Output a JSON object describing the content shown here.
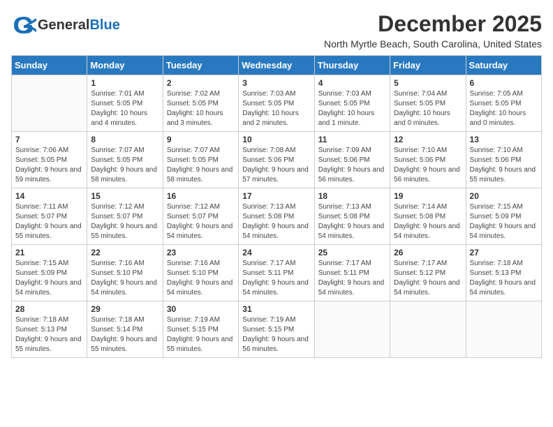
{
  "header": {
    "logo_general": "General",
    "logo_blue": "Blue",
    "month_title": "December 2025",
    "location": "North Myrtle Beach, South Carolina, United States"
  },
  "days_of_week": [
    "Sunday",
    "Monday",
    "Tuesday",
    "Wednesday",
    "Thursday",
    "Friday",
    "Saturday"
  ],
  "weeks": [
    [
      {
        "day": "",
        "sunrise": "",
        "sunset": "",
        "daylight": ""
      },
      {
        "day": "1",
        "sunrise": "Sunrise: 7:01 AM",
        "sunset": "Sunset: 5:05 PM",
        "daylight": "Daylight: 10 hours and 4 minutes."
      },
      {
        "day": "2",
        "sunrise": "Sunrise: 7:02 AM",
        "sunset": "Sunset: 5:05 PM",
        "daylight": "Daylight: 10 hours and 3 minutes."
      },
      {
        "day": "3",
        "sunrise": "Sunrise: 7:03 AM",
        "sunset": "Sunset: 5:05 PM",
        "daylight": "Daylight: 10 hours and 2 minutes."
      },
      {
        "day": "4",
        "sunrise": "Sunrise: 7:03 AM",
        "sunset": "Sunset: 5:05 PM",
        "daylight": "Daylight: 10 hours and 1 minute."
      },
      {
        "day": "5",
        "sunrise": "Sunrise: 7:04 AM",
        "sunset": "Sunset: 5:05 PM",
        "daylight": "Daylight: 10 hours and 0 minutes."
      },
      {
        "day": "6",
        "sunrise": "Sunrise: 7:05 AM",
        "sunset": "Sunset: 5:05 PM",
        "daylight": "Daylight: 10 hours and 0 minutes."
      }
    ],
    [
      {
        "day": "7",
        "sunrise": "Sunrise: 7:06 AM",
        "sunset": "Sunset: 5:05 PM",
        "daylight": "Daylight: 9 hours and 59 minutes."
      },
      {
        "day": "8",
        "sunrise": "Sunrise: 7:07 AM",
        "sunset": "Sunset: 5:05 PM",
        "daylight": "Daylight: 9 hours and 58 minutes."
      },
      {
        "day": "9",
        "sunrise": "Sunrise: 7:07 AM",
        "sunset": "Sunset: 5:05 PM",
        "daylight": "Daylight: 9 hours and 58 minutes."
      },
      {
        "day": "10",
        "sunrise": "Sunrise: 7:08 AM",
        "sunset": "Sunset: 5:06 PM",
        "daylight": "Daylight: 9 hours and 57 minutes."
      },
      {
        "day": "11",
        "sunrise": "Sunrise: 7:09 AM",
        "sunset": "Sunset: 5:06 PM",
        "daylight": "Daylight: 9 hours and 56 minutes."
      },
      {
        "day": "12",
        "sunrise": "Sunrise: 7:10 AM",
        "sunset": "Sunset: 5:06 PM",
        "daylight": "Daylight: 9 hours and 56 minutes."
      },
      {
        "day": "13",
        "sunrise": "Sunrise: 7:10 AM",
        "sunset": "Sunset: 5:06 PM",
        "daylight": "Daylight: 9 hours and 55 minutes."
      }
    ],
    [
      {
        "day": "14",
        "sunrise": "Sunrise: 7:11 AM",
        "sunset": "Sunset: 5:07 PM",
        "daylight": "Daylight: 9 hours and 55 minutes."
      },
      {
        "day": "15",
        "sunrise": "Sunrise: 7:12 AM",
        "sunset": "Sunset: 5:07 PM",
        "daylight": "Daylight: 9 hours and 55 minutes."
      },
      {
        "day": "16",
        "sunrise": "Sunrise: 7:12 AM",
        "sunset": "Sunset: 5:07 PM",
        "daylight": "Daylight: 9 hours and 54 minutes."
      },
      {
        "day": "17",
        "sunrise": "Sunrise: 7:13 AM",
        "sunset": "Sunset: 5:08 PM",
        "daylight": "Daylight: 9 hours and 54 minutes."
      },
      {
        "day": "18",
        "sunrise": "Sunrise: 7:13 AM",
        "sunset": "Sunset: 5:08 PM",
        "daylight": "Daylight: 9 hours and 54 minutes."
      },
      {
        "day": "19",
        "sunrise": "Sunrise: 7:14 AM",
        "sunset": "Sunset: 5:08 PM",
        "daylight": "Daylight: 9 hours and 54 minutes."
      },
      {
        "day": "20",
        "sunrise": "Sunrise: 7:15 AM",
        "sunset": "Sunset: 5:09 PM",
        "daylight": "Daylight: 9 hours and 54 minutes."
      }
    ],
    [
      {
        "day": "21",
        "sunrise": "Sunrise: 7:15 AM",
        "sunset": "Sunset: 5:09 PM",
        "daylight": "Daylight: 9 hours and 54 minutes."
      },
      {
        "day": "22",
        "sunrise": "Sunrise: 7:16 AM",
        "sunset": "Sunset: 5:10 PM",
        "daylight": "Daylight: 9 hours and 54 minutes."
      },
      {
        "day": "23",
        "sunrise": "Sunrise: 7:16 AM",
        "sunset": "Sunset: 5:10 PM",
        "daylight": "Daylight: 9 hours and 54 minutes."
      },
      {
        "day": "24",
        "sunrise": "Sunrise: 7:17 AM",
        "sunset": "Sunset: 5:11 PM",
        "daylight": "Daylight: 9 hours and 54 minutes."
      },
      {
        "day": "25",
        "sunrise": "Sunrise: 7:17 AM",
        "sunset": "Sunset: 5:11 PM",
        "daylight": "Daylight: 9 hours and 54 minutes."
      },
      {
        "day": "26",
        "sunrise": "Sunrise: 7:17 AM",
        "sunset": "Sunset: 5:12 PM",
        "daylight": "Daylight: 9 hours and 54 minutes."
      },
      {
        "day": "27",
        "sunrise": "Sunrise: 7:18 AM",
        "sunset": "Sunset: 5:13 PM",
        "daylight": "Daylight: 9 hours and 54 minutes."
      }
    ],
    [
      {
        "day": "28",
        "sunrise": "Sunrise: 7:18 AM",
        "sunset": "Sunset: 5:13 PM",
        "daylight": "Daylight: 9 hours and 55 minutes."
      },
      {
        "day": "29",
        "sunrise": "Sunrise: 7:18 AM",
        "sunset": "Sunset: 5:14 PM",
        "daylight": "Daylight: 9 hours and 55 minutes."
      },
      {
        "day": "30",
        "sunrise": "Sunrise: 7:19 AM",
        "sunset": "Sunset: 5:15 PM",
        "daylight": "Daylight: 9 hours and 55 minutes."
      },
      {
        "day": "31",
        "sunrise": "Sunrise: 7:19 AM",
        "sunset": "Sunset: 5:15 PM",
        "daylight": "Daylight: 9 hours and 56 minutes."
      },
      {
        "day": "",
        "sunrise": "",
        "sunset": "",
        "daylight": ""
      },
      {
        "day": "",
        "sunrise": "",
        "sunset": "",
        "daylight": ""
      },
      {
        "day": "",
        "sunrise": "",
        "sunset": "",
        "daylight": ""
      }
    ]
  ]
}
